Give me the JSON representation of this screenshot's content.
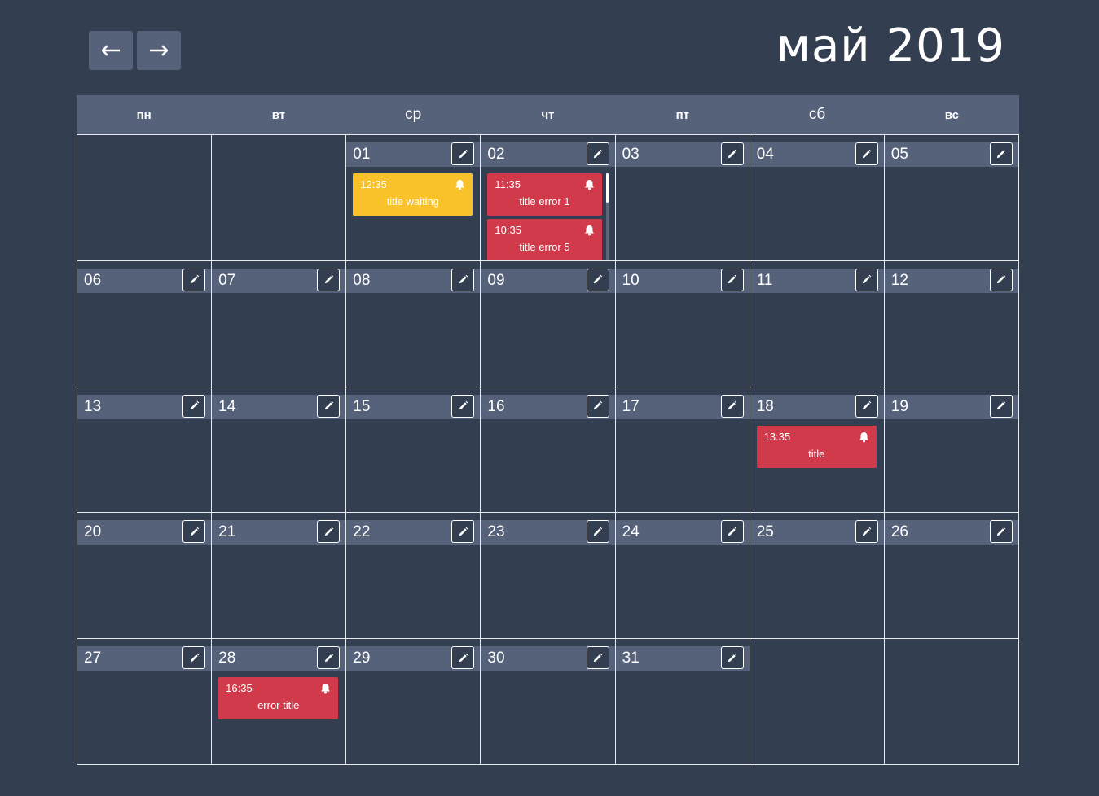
{
  "header": {
    "month_title": "май 2019",
    "prev_icon": "arrow-left-icon",
    "next_icon": "arrow-right-icon"
  },
  "weekdays": [
    "пн",
    "вт",
    "ср",
    "чт",
    "пт",
    "сб",
    "вс"
  ],
  "colors": {
    "background": "#333e50",
    "header_bar": "#56627a",
    "event_waiting": "#f9c22a",
    "event_error": "#d13a4b"
  },
  "days": [
    {
      "num": ""
    },
    {
      "num": ""
    },
    {
      "num": "01",
      "events": [
        {
          "time": "12:35",
          "title": "title waiting",
          "status": "waiting"
        }
      ]
    },
    {
      "num": "02",
      "scroll": true,
      "events": [
        {
          "time": "11:35",
          "title": "title error 1",
          "status": "error"
        },
        {
          "time": "10:35",
          "title": "title error 5",
          "status": "error"
        }
      ]
    },
    {
      "num": "03"
    },
    {
      "num": "04"
    },
    {
      "num": "05"
    },
    {
      "num": "06"
    },
    {
      "num": "07"
    },
    {
      "num": "08"
    },
    {
      "num": "09"
    },
    {
      "num": "10"
    },
    {
      "num": "11"
    },
    {
      "num": "12"
    },
    {
      "num": "13"
    },
    {
      "num": "14"
    },
    {
      "num": "15"
    },
    {
      "num": "16"
    },
    {
      "num": "17"
    },
    {
      "num": "18",
      "events": [
        {
          "time": "13:35",
          "title": "title",
          "status": "error"
        }
      ]
    },
    {
      "num": "19"
    },
    {
      "num": "20"
    },
    {
      "num": "21"
    },
    {
      "num": "22"
    },
    {
      "num": "23"
    },
    {
      "num": "24"
    },
    {
      "num": "25"
    },
    {
      "num": "26"
    },
    {
      "num": "27"
    },
    {
      "num": "28",
      "events": [
        {
          "time": "16:35",
          "title": "error title",
          "status": "error"
        }
      ]
    },
    {
      "num": "29"
    },
    {
      "num": "30"
    },
    {
      "num": "31"
    },
    {
      "num": ""
    },
    {
      "num": ""
    }
  ]
}
